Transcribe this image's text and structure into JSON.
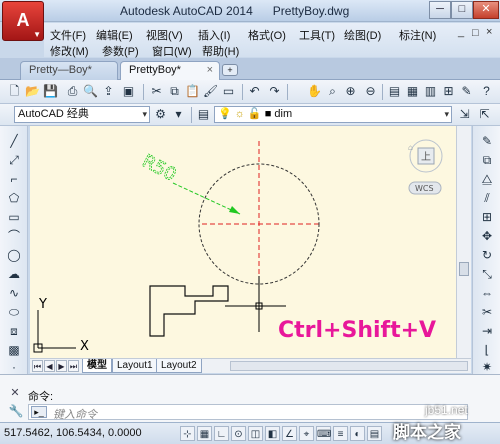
{
  "window": {
    "app_button_glyph": "A",
    "title": "Autodesk AutoCAD 2014",
    "filename": "PrettyBoy.dwg",
    "min_glyph": "─",
    "max_glyph": "□",
    "close_glyph": "✕"
  },
  "menu": {
    "row1": [
      "文件(F)",
      "编辑(E)",
      "视图(V)",
      "插入(I)",
      "格式(O)",
      "工具(T)",
      "绘图(D)",
      "标注(N)"
    ],
    "row2": [
      "修改(M)",
      "参数(P)",
      "窗口(W)",
      "帮助(H)"
    ],
    "mdi_min": "_",
    "mdi_restore": "□",
    "mdi_close": "×"
  },
  "tabs": [
    {
      "label": "Pretty—Boy*"
    },
    {
      "label": "PrettyBoy*",
      "close": "×"
    }
  ],
  "new_tab_glyph": "+",
  "toolbar": {
    "workspace": "AutoCAD 经典",
    "layer": "dim",
    "dropdown_arrow": "▾"
  },
  "canvas": {
    "radius_label": "R50",
    "viewcube_face": "上",
    "wcs_label": "WCS",
    "ucs_x": "X",
    "ucs_y": "Y",
    "circle_color": "#333333",
    "centerline_color": "#e02020",
    "leader_color": "#22c822",
    "background": "#fdf8e0"
  },
  "layout_tabs": [
    "模型",
    "Layout1",
    "Layout2"
  ],
  "command": {
    "history": "命令:",
    "placeholder": "键入命令",
    "prompt_glyph": "▸_"
  },
  "status": {
    "coords": "517.5462, 106.5434, 0.0000"
  },
  "overlay": {
    "shortcut": "Ctrl+Shift+V",
    "site": "jb51.net",
    "brand": "脚本之家"
  }
}
